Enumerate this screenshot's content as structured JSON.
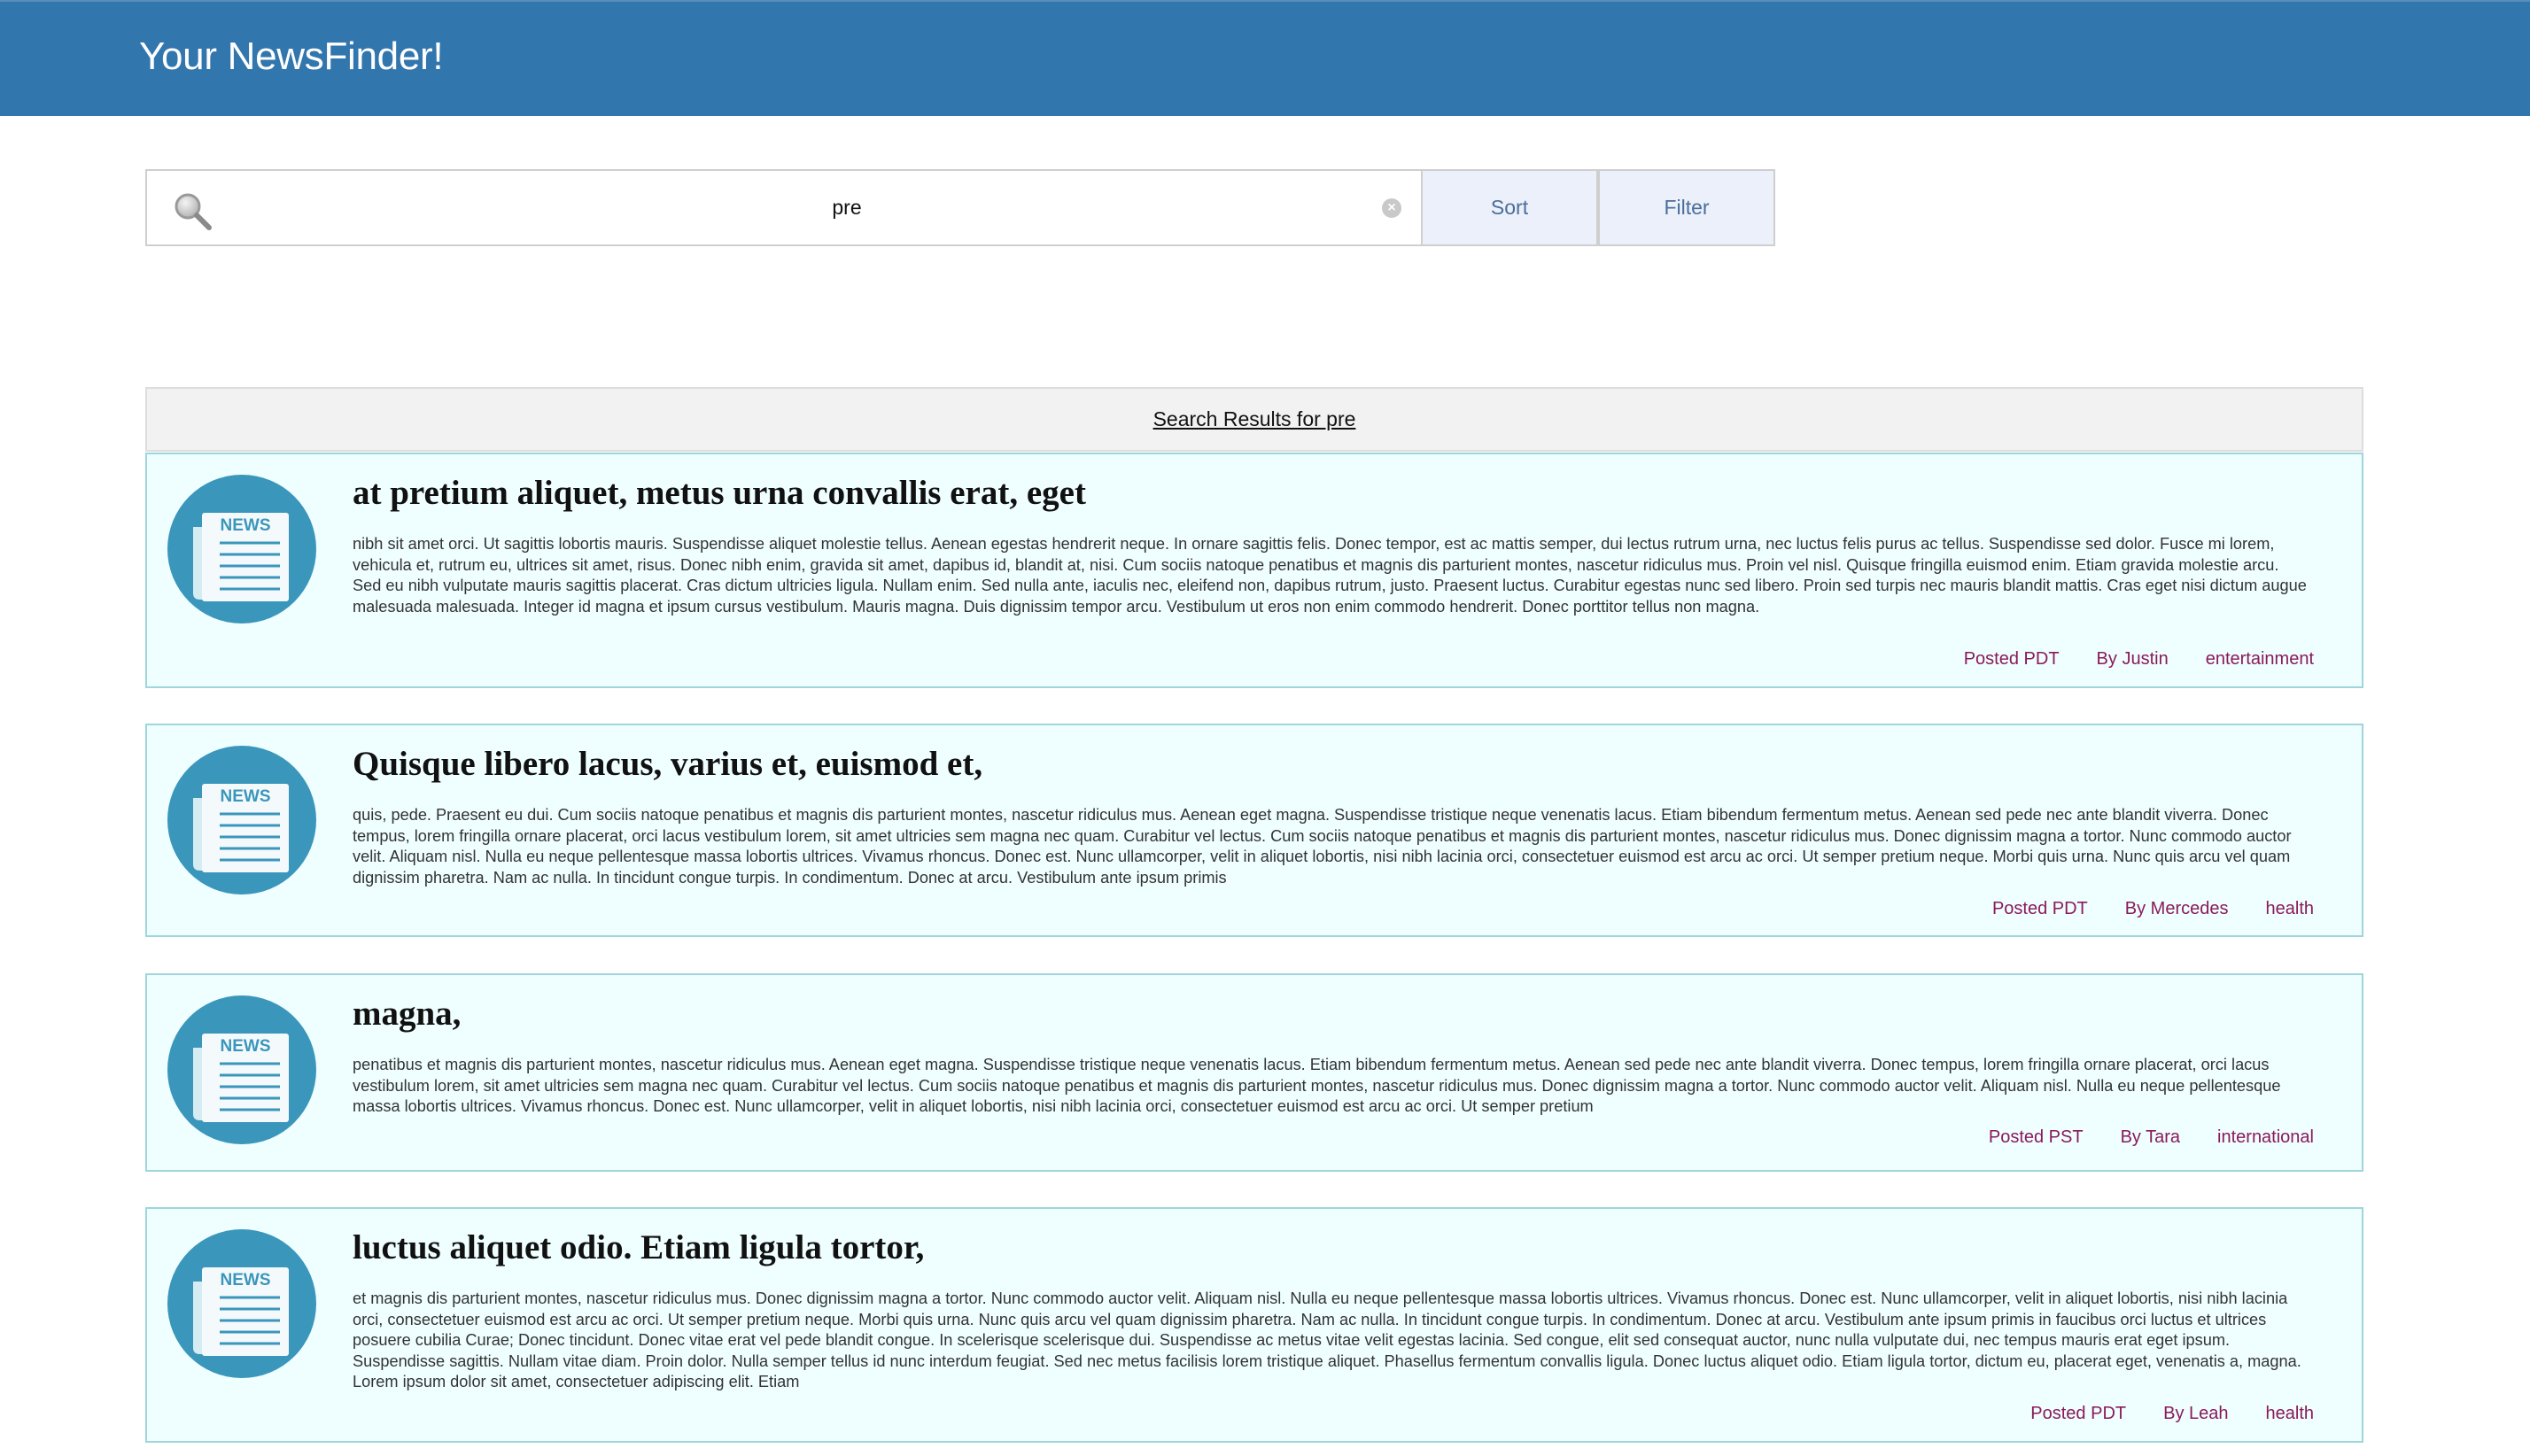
{
  "header": {
    "title": "Your NewsFinder!"
  },
  "search": {
    "value": "pre",
    "sort_label": "Sort",
    "filter_label": "Filter"
  },
  "results": {
    "heading": "Search Results for pre",
    "articles": [
      {
        "icon_label": "NEWS",
        "title": "at pretium aliquet, metus urna convallis erat, eget",
        "body": "nibh sit amet orci. Ut sagittis lobortis mauris. Suspendisse aliquet molestie tellus. Aenean egestas hendrerit neque. In ornare sagittis felis. Donec tempor, est ac mattis semper, dui lectus rutrum urna, nec luctus felis purus ac tellus. Suspendisse sed dolor. Fusce mi lorem, vehicula et, rutrum eu, ultrices sit amet, risus. Donec nibh enim, gravida sit amet, dapibus id, blandit at, nisi. Cum sociis natoque penatibus et magnis dis parturient montes, nascetur ridiculus mus. Proin vel nisl. Quisque fringilla euismod enim. Etiam gravida molestie arcu. Sed eu nibh vulputate mauris sagittis placerat. Cras dictum ultricies ligula. Nullam enim. Sed nulla ante, iaculis nec, eleifend non, dapibus rutrum, justo. Praesent luctus. Curabitur egestas nunc sed libero. Proin sed turpis nec mauris blandit mattis. Cras eget nisi dictum augue malesuada malesuada. Integer id magna et ipsum cursus vestibulum. Mauris magna. Duis dignissim tempor arcu. Vestibulum ut eros non enim commodo hendrerit. Donec porttitor tellus non magna.",
        "posted": "Posted PDT",
        "author": "By Justin",
        "category": "entertainment"
      },
      {
        "icon_label": "NEWS",
        "title": "Quisque libero lacus, varius et, euismod et,",
        "body": "quis, pede. Praesent eu dui. Cum sociis natoque penatibus et magnis dis parturient montes, nascetur ridiculus mus. Aenean eget magna. Suspendisse tristique neque venenatis lacus. Etiam bibendum fermentum metus. Aenean sed pede nec ante blandit viverra. Donec tempus, lorem fringilla ornare placerat, orci lacus vestibulum lorem, sit amet ultricies sem magna nec quam. Curabitur vel lectus. Cum sociis natoque penatibus et magnis dis parturient montes, nascetur ridiculus mus. Donec dignissim magna a tortor. Nunc commodo auctor velit. Aliquam nisl. Nulla eu neque pellentesque massa lobortis ultrices. Vivamus rhoncus. Donec est. Nunc ullamcorper, velit in aliquet lobortis, nisi nibh lacinia orci, consectetuer euismod est arcu ac orci. Ut semper pretium neque. Morbi quis urna. Nunc quis arcu vel quam dignissim pharetra. Nam ac nulla. In tincidunt congue turpis. In condimentum. Donec at arcu. Vestibulum ante ipsum primis",
        "posted": "Posted PDT",
        "author": "By Mercedes",
        "category": "health"
      },
      {
        "icon_label": "NEWS",
        "title": "magna,",
        "body": "penatibus et magnis dis parturient montes, nascetur ridiculus mus. Aenean eget magna. Suspendisse tristique neque venenatis lacus. Etiam bibendum fermentum metus. Aenean sed pede nec ante blandit viverra. Donec tempus, lorem fringilla ornare placerat, orci lacus vestibulum lorem, sit amet ultricies sem magna nec quam. Curabitur vel lectus. Cum sociis natoque penatibus et magnis dis parturient montes, nascetur ridiculus mus. Donec dignissim magna a tortor. Nunc commodo auctor velit. Aliquam nisl. Nulla eu neque pellentesque massa lobortis ultrices. Vivamus rhoncus. Donec est. Nunc ullamcorper, velit in aliquet lobortis, nisi nibh lacinia orci, consectetuer euismod est arcu ac orci. Ut semper pretium",
        "posted": "Posted PST",
        "author": "By Tara",
        "category": "international"
      },
      {
        "icon_label": "NEWS",
        "title": "luctus aliquet odio. Etiam ligula tortor,",
        "body": "et magnis dis parturient montes, nascetur ridiculus mus. Donec dignissim magna a tortor. Nunc commodo auctor velit. Aliquam nisl. Nulla eu neque pellentesque massa lobortis ultrices. Vivamus rhoncus. Donec est. Nunc ullamcorper, velit in aliquet lobortis, nisi nibh lacinia orci, consectetuer euismod est arcu ac orci. Ut semper pretium neque. Morbi quis urna. Nunc quis arcu vel quam dignissim pharetra. Nam ac nulla. In tincidunt congue turpis. In condimentum. Donec at arcu. Vestibulum ante ipsum primis in faucibus orci luctus et ultrices posuere cubilia Curae; Donec tincidunt. Donec vitae erat vel pede blandit congue. In scelerisque scelerisque dui. Suspendisse ac metus vitae velit egestas lacinia. Sed congue, elit sed consequat auctor, nunc nulla vulputate dui, nec tempus mauris erat eget ipsum. Suspendisse sagittis. Nullam vitae diam. Proin dolor. Nulla semper tellus id nunc interdum feugiat. Sed nec metus facilisis lorem tristique aliquet. Phasellus fermentum convallis ligula. Donec luctus aliquet odio. Etiam ligula tortor, dictum eu, placerat eget, venenatis a, magna. Lorem ipsum dolor sit amet, consectetuer adipiscing elit. Etiam",
        "posted": "Posted PDT",
        "author": "By Leah",
        "category": "health"
      }
    ]
  },
  "colors": {
    "header_bg": "#3276ae",
    "card_bg": "#effeff",
    "card_border": "#9fd6dc",
    "meta_text": "#8a1a5a",
    "button_bg": "#ebf0fa",
    "icon_circle": "#3a96bb"
  }
}
